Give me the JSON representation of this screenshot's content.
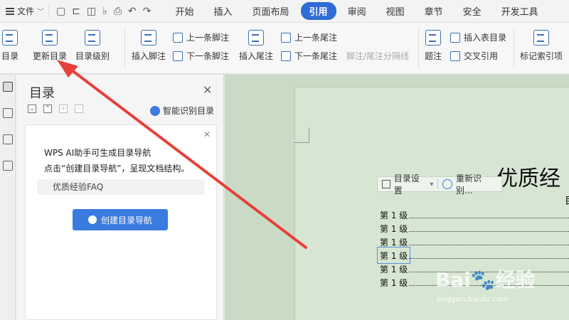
{
  "menubar": {
    "file_label": "文件",
    "tabs": [
      "开始",
      "插入",
      "页面布局",
      "引用",
      "审阅",
      "视图",
      "章节",
      "安全",
      "开发工具"
    ],
    "active_tab": "引用"
  },
  "ribbon": {
    "toc": "目录",
    "update_toc": "更新目录",
    "toc_level": "目录级别",
    "insert_footnote": "插入脚注",
    "prev_footnote": "上一条脚注",
    "next_footnote": "下一条脚注",
    "insert_endnote": "插入尾注",
    "prev_endnote": "上一条尾注",
    "next_endnote": "下一条尾注",
    "note_separator": "脚注/尾注分隔线",
    "caption": "题注",
    "insert_table_of_figures": "插入表目录",
    "cross_reference": "交叉引用",
    "mark_index_entry": "标记索引项"
  },
  "nav": {
    "title": "目录",
    "smart_detect": "智能识别目录",
    "ai_line1": "WPS AI助手可生成目录导航",
    "ai_line2": "点击“创建目录导航”，呈现文档结构。",
    "faq": "优质经验FAQ",
    "create_button": "创建目录导航"
  },
  "document": {
    "title": "优质经",
    "subtitle": "目",
    "toc_settings": "目录设置",
    "re_detect": "重新识别...",
    "toc_entries": [
      "第 1 级",
      "第 1 级",
      "第 1 级",
      "第 1 级",
      "第 1 级",
      "第 1 级"
    ]
  },
  "watermark": {
    "brand": "Bai",
    "brand_suffix": "经验",
    "url": "jingyan.baidu.com"
  },
  "colors": {
    "accent": "#2e6cd6",
    "doc_background": "#c9dbc5",
    "arrow": "#e8403a"
  }
}
